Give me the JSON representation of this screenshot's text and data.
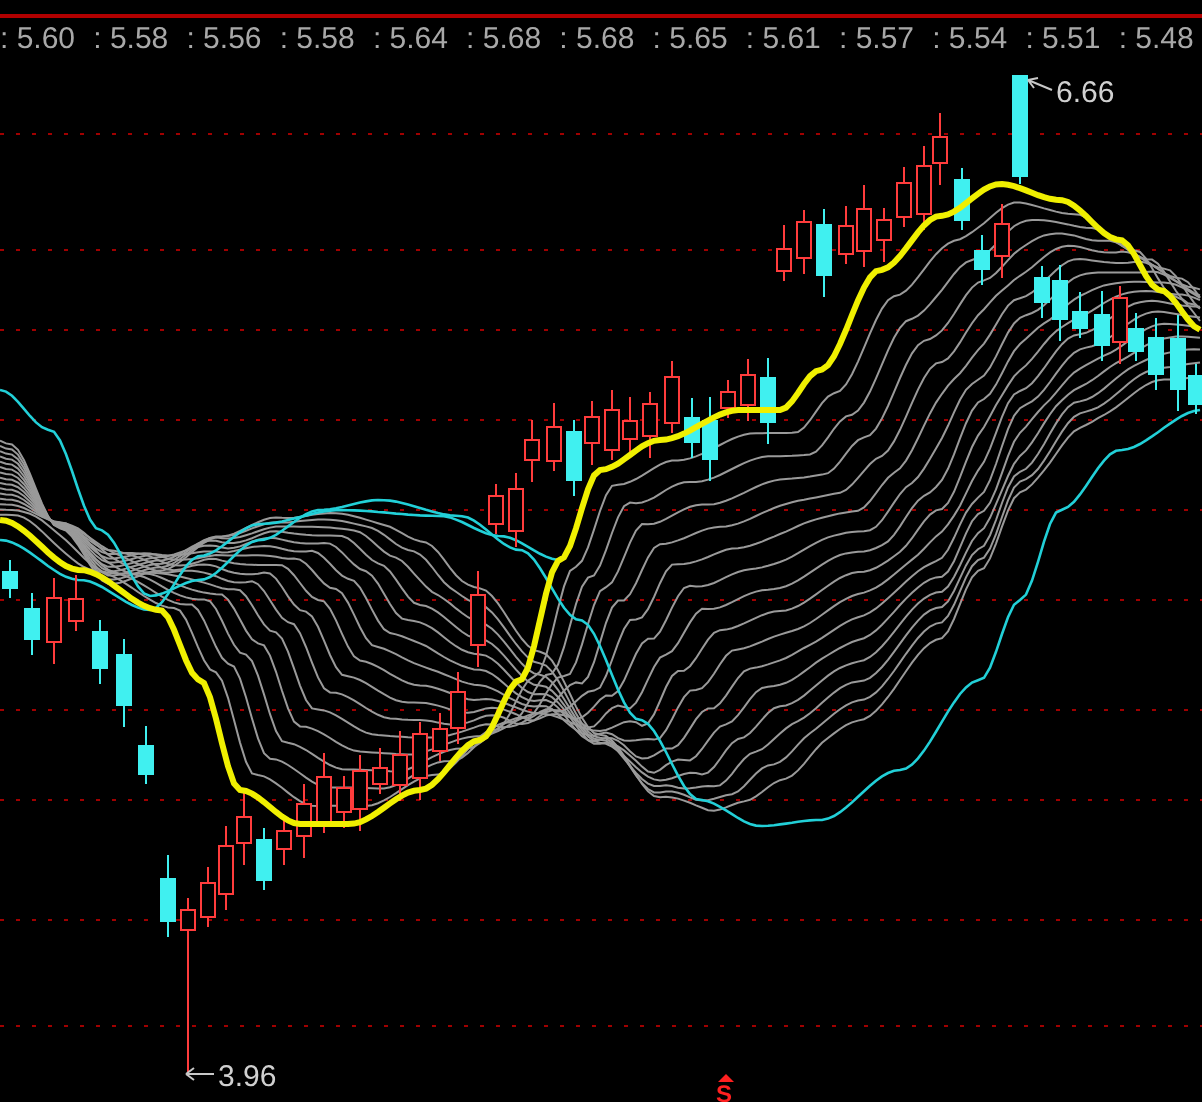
{
  "price_strip": [
    ": 5.60",
    ": 5.58",
    ": 5.56",
    ": 5.58",
    ": 5.64",
    ": 5.68",
    ": 5.68",
    ": 5.65",
    ": 5.61",
    ": 5.57",
    ": 5.54",
    ": 5.51",
    ": 5.48"
  ],
  "chart": {
    "high_label": "6.66",
    "low_label": "3.96",
    "signal_marker": "S"
  }
}
